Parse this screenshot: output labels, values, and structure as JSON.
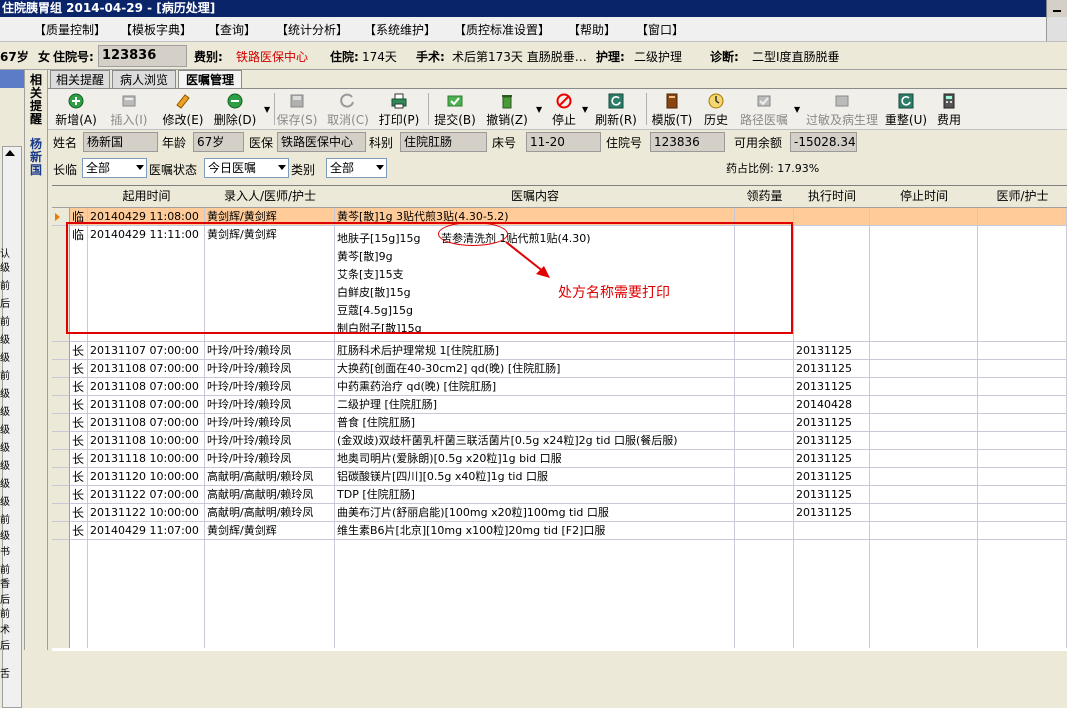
{
  "titlebar": {
    "text": "住院胰胃组   2014-04-29 - [病历处理]"
  },
  "menu": [
    "【质量控制】",
    "【模板字典】",
    "【查询】",
    "【统计分析】",
    "【系统维护】",
    "【质控标准设置】",
    "【帮助】",
    "【窗口】"
  ],
  "patient": {
    "age_prefix": "67岁",
    "sex_label": "女",
    "inpatient_no_label": "住院号:",
    "inpatient_no": "123836",
    "insurance_label": "费别:",
    "insurance": "铁路医保中心",
    "stay_label": "住院:",
    "stay": "174天",
    "surgery_label": "手术:",
    "surgery": "术后第173天  直肠脱垂…",
    "care_label": "护理:",
    "care": "二级护理",
    "diagnosis_label": "诊断:",
    "diagnosis": "二型Ⅰ度直肠脱垂"
  },
  "vertical_tabs": [
    "相关提醒",
    "杨新国"
  ],
  "left_glyphs": [
    "认",
    "级",
    "前",
    "后",
    "前",
    "级",
    "级",
    "前",
    "级",
    "级",
    "级",
    "级",
    "级",
    "级",
    "级",
    "前",
    "级",
    "书",
    "前",
    "香",
    "后",
    "前",
    "术",
    "后",
    "舌"
  ],
  "tabs": [
    {
      "label": "相关提醒",
      "active": false
    },
    {
      "label": "病人浏览",
      "active": false
    },
    {
      "label": "医嘱管理",
      "active": true
    }
  ],
  "toolbar": [
    {
      "label": "新增(A)",
      "icon": "add-icon",
      "enabled": true
    },
    {
      "label": "插入(I)",
      "icon": "insert-icon",
      "enabled": false
    },
    {
      "label": "修改(E)",
      "icon": "edit-icon",
      "enabled": true
    },
    {
      "label": "删除(D)",
      "icon": "delete-icon",
      "enabled": true
    },
    {
      "label": "保存(S)",
      "icon": "save-icon",
      "enabled": false
    },
    {
      "label": "取消(C)",
      "icon": "cancel-icon",
      "enabled": false
    },
    {
      "label": "打印(P)",
      "icon": "print-icon",
      "enabled": true
    },
    {
      "label": "提交(B)",
      "icon": "submit-icon",
      "enabled": true
    },
    {
      "label": "撤销(Z)",
      "icon": "undo-icon",
      "enabled": true
    },
    {
      "label": "停止",
      "icon": "stop-icon",
      "enabled": true
    },
    {
      "label": "刷新(R)",
      "icon": "refresh-icon",
      "enabled": true
    },
    {
      "label": "模版(T)",
      "icon": "template-icon",
      "enabled": true
    },
    {
      "label": "历史",
      "icon": "history-icon",
      "enabled": true
    },
    {
      "label": "路径医嘱",
      "icon": "pathway-icon",
      "enabled": false
    },
    {
      "label": "过敏及病生理",
      "icon": "allergy-icon",
      "enabled": false
    },
    {
      "label": "重整(U)",
      "icon": "reorganize-icon",
      "enabled": true
    },
    {
      "label": "费用",
      "icon": "cost-icon",
      "enabled": true
    }
  ],
  "info": {
    "name_label": "姓名",
    "name": "杨新国",
    "age_label": "年龄",
    "age": "67岁",
    "insurance_label": "医保",
    "insurance": "铁路医保中心",
    "dept_label": "科别",
    "dept": "住院肛肠",
    "bed_label": "床号",
    "bed": "11-20",
    "inpatient_label": "住院号",
    "inpatient": "123836",
    "balance_label": "可用余额",
    "balance": "-15028.34"
  },
  "filters": {
    "longtemp_label": "长临",
    "longtemp": "全部",
    "status_label": "医嘱状态",
    "status": "今日医嘱",
    "type_label": "类别",
    "type": "全部",
    "ratio": "药占比例: 17.93%"
  },
  "grid": {
    "headers": [
      "起用时间",
      "录入人/医师/护士",
      "医嘱内容",
      "领药量",
      "执行时间",
      "停止时间",
      "医师/护士"
    ],
    "rows": [
      {
        "kind": "临",
        "start": "20140429 11:08:00",
        "staff": "黄剑辉/黄剑辉",
        "content": [
          "黄芩[散]1g   3贴代煎3贴(4.30-5.2)"
        ],
        "exec": "",
        "selected": true
      },
      {
        "kind": "临",
        "start": "20140429 11:11:00",
        "staff": "黄剑辉/黄剑辉",
        "content": [
          "地肤子[15g]15g",
          "黄芩[散]9g",
          "艾条[支]15支",
          "白鲜皮[散]15g",
          "豆蔻[4.5g]15g",
          "制白附子[散]15g"
        ],
        "extra": "苦参清洗剂 1贴代煎1贴(4.30)",
        "exec": "",
        "selected": false
      },
      {
        "kind": "长",
        "start": "20131107 07:00:00",
        "staff": "叶玲/叶玲/赖玲凤",
        "content": [
          "肛肠科术后护理常规   1[住院肛肠]"
        ],
        "exec": "20131125",
        "selected": false
      },
      {
        "kind": "长",
        "start": "20131108 07:00:00",
        "staff": "叶玲/叶玲/赖玲凤",
        "content": [
          "大换药[创面在40-30cm2] qd(晚) [住院肛肠]"
        ],
        "exec": "20131125",
        "selected": false
      },
      {
        "kind": "长",
        "start": "20131108 07:00:00",
        "staff": "叶玲/叶玲/赖玲凤",
        "content": [
          "中药熏药治疗 qd(晚)  [住院肛肠]"
        ],
        "exec": "20131125",
        "selected": false
      },
      {
        "kind": "长",
        "start": "20131108 07:00:00",
        "staff": "叶玲/叶玲/赖玲凤",
        "content": [
          "二级护理   [住院肛肠]"
        ],
        "exec": "20140428",
        "selected": false
      },
      {
        "kind": "长",
        "start": "20131108 07:00:00",
        "staff": "叶玲/叶玲/赖玲凤",
        "content": [
          "普食   [住院肛肠]"
        ],
        "exec": "20131125",
        "selected": false
      },
      {
        "kind": "长",
        "start": "20131108 10:00:00",
        "staff": "叶玲/叶玲/赖玲凤",
        "content": [
          "(金双歧)双歧杆菌乳杆菌三联活菌片[0.5g x24粒]2g   tid 口服(餐后服)"
        ],
        "exec": "20131125",
        "selected": false
      },
      {
        "kind": "长",
        "start": "20131118 10:00:00",
        "staff": "叶玲/叶玲/赖玲凤",
        "content": [
          "地奥司明片(爱脉朗)[0.5g x20粒]1g   bid 口服"
        ],
        "exec": "20131125",
        "selected": false
      },
      {
        "kind": "长",
        "start": "20131120 10:00:00",
        "staff": "高献明/高献明/赖玲凤",
        "content": [
          "铝碳酸镁片[四川][0.5g x40粒]1g   tid 口服"
        ],
        "exec": "20131125",
        "selected": false
      },
      {
        "kind": "长",
        "start": "20131122 07:00:00",
        "staff": "高献明/高献明/赖玲凤",
        "content": [
          "TDP   [住院肛肠]"
        ],
        "exec": "20131125",
        "selected": false
      },
      {
        "kind": "长",
        "start": "20131122 10:00:00",
        "staff": "高献明/高献明/赖玲凤",
        "content": [
          "曲美布汀片(舒丽启能)[100mg x20粒]100mg   tid 口服"
        ],
        "exec": "20131125",
        "selected": false
      },
      {
        "kind": "长",
        "start": "20140429 11:07:00",
        "staff": "黄剑辉/黄剑辉",
        "content": [
          "维生素B6片[北京][10mg x100粒]20mg   tid [F2]口服"
        ],
        "exec": "",
        "selected": false
      }
    ]
  },
  "annotation": {
    "text": "处方名称需要打印",
    "circled": "苦参清洗剂",
    "color": "#e00000"
  }
}
